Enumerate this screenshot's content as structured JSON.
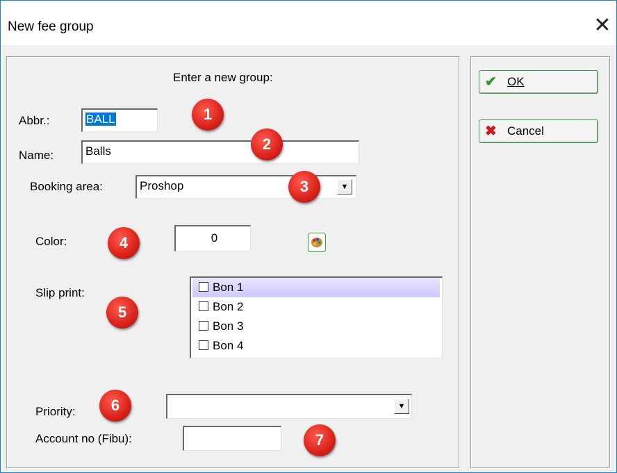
{
  "window": {
    "title": "New fee group",
    "close_glyph": "✕"
  },
  "form": {
    "heading": "Enter a new group:",
    "abbr_label": "Abbr.:",
    "abbr_value": "BALL",
    "name_label": "Name:",
    "name_value": "Balls",
    "booking_label": "Booking area:",
    "booking_value": "Proshop",
    "color_label": "Color:",
    "color_value": "0",
    "slip_label": "Slip print:",
    "slip_items": [
      {
        "label": "Bon 1",
        "checked": false,
        "selected": true
      },
      {
        "label": "Bon 2",
        "checked": false,
        "selected": false
      },
      {
        "label": "Bon 3",
        "checked": false,
        "selected": false
      },
      {
        "label": "Bon 4",
        "checked": false,
        "selected": false
      }
    ],
    "priority_label": "Priority:",
    "priority_value": "",
    "account_label": "Account no (Fibu):",
    "account_value": ""
  },
  "buttons": {
    "ok_label": "OK",
    "ok_icon": "checkmark-icon",
    "cancel_label": "Cancel",
    "cancel_icon": "x-icon"
  },
  "annotations": [
    "1",
    "2",
    "3",
    "4",
    "5",
    "6",
    "7"
  ],
  "colors": {
    "accent": "#1883d7",
    "badge": "#d8221a",
    "button_border": "#36a346",
    "selection": "#0078d7"
  }
}
